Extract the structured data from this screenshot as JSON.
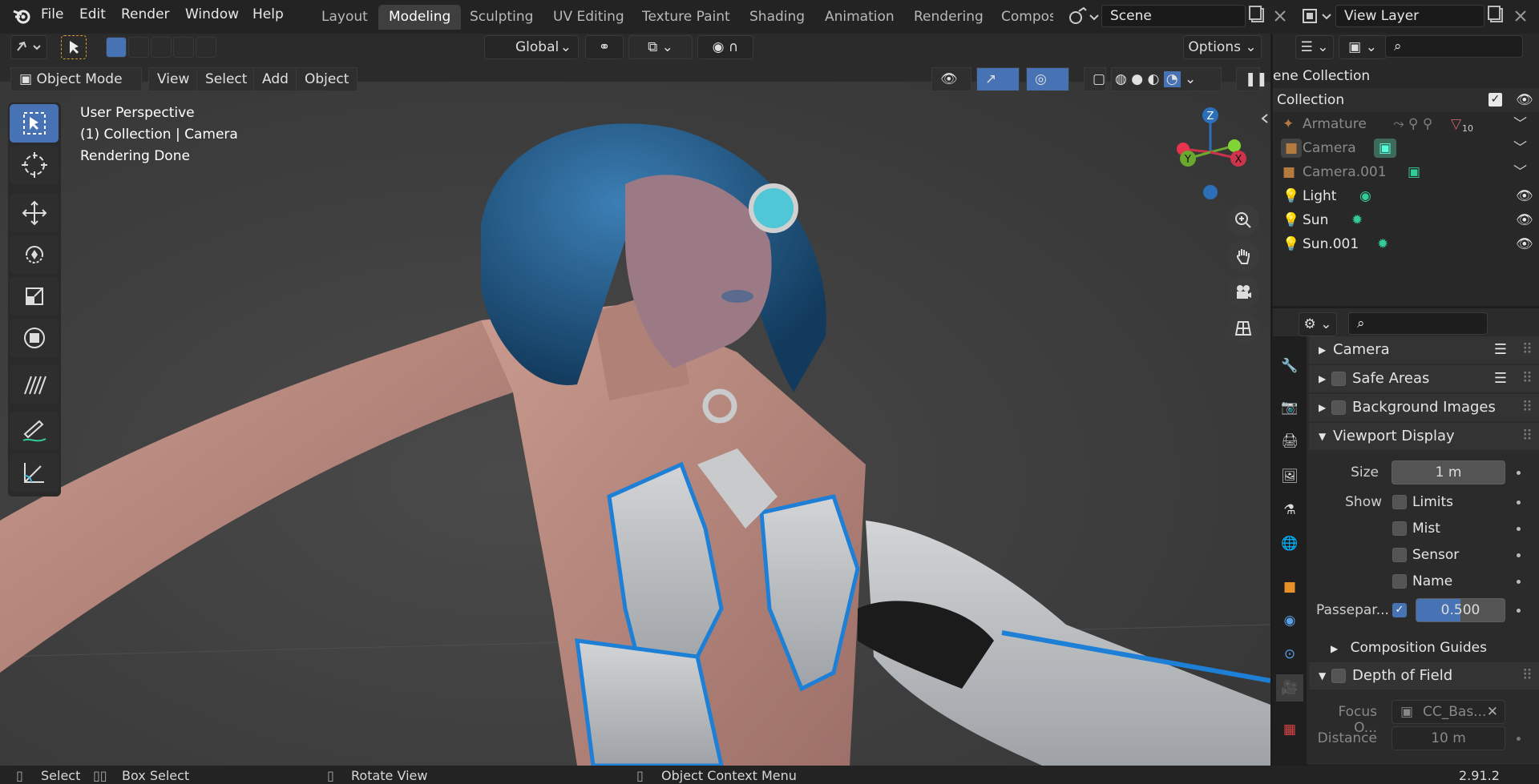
{
  "topbar": {
    "menus": [
      "File",
      "Edit",
      "Render",
      "Window",
      "Help"
    ],
    "workspaces": [
      "Layout",
      "Modeling",
      "Sculpting",
      "UV Editing",
      "Texture Paint",
      "Shading",
      "Animation",
      "Rendering",
      "Compos"
    ],
    "active_workspace": "Modeling",
    "scene": "Scene",
    "view_layer": "View Layer"
  },
  "header": {
    "transform_orientation": "Global",
    "options": "Options",
    "mode": "Object Mode",
    "menus": [
      "View",
      "Select",
      "Add",
      "Object"
    ]
  },
  "viewport": {
    "perspective": "User Perspective",
    "collection_info": "(1) Collection | Camera",
    "status": "Rendering Done",
    "gizmo": {
      "z": "Z",
      "y": "Y",
      "x": "X"
    }
  },
  "outliner": {
    "scene_collection": "ene Collection",
    "collection": "Collection",
    "items": [
      {
        "name": "Armature",
        "icon": "armature-icon",
        "dim": true
      },
      {
        "name": "Camera",
        "icon": "camera-object-icon",
        "dim": true,
        "selected": true
      },
      {
        "name": "Camera.001",
        "icon": "camera-object-icon",
        "dim": true
      },
      {
        "name": "Light",
        "icon": "light-icon",
        "dim": false
      },
      {
        "name": "Sun",
        "icon": "light-icon",
        "dim": false
      },
      {
        "name": "Sun.001",
        "icon": "light-icon",
        "dim": false
      }
    ],
    "armature_badge": "10"
  },
  "properties": {
    "panels": {
      "camera": "Camera",
      "safe_areas": "Safe Areas",
      "background_images": "Background Images",
      "viewport_display": "Viewport Display",
      "composition_guides": "Composition Guides",
      "depth_of_field": "Depth of Field"
    },
    "size_label": "Size",
    "size_value": "1 m",
    "show_label": "Show",
    "show_options": [
      "Limits",
      "Mist",
      "Sensor",
      "Name"
    ],
    "passepartout_label": "Passepar...",
    "passepartout_value": "0.500",
    "passepartout_fraction": 0.5,
    "focus_label": "Focus O...",
    "focus_value": "CC_Bas...",
    "distance_label": "Distance",
    "distance_value": "10 m"
  },
  "statusbar": {
    "select": "Select",
    "box_select": "Box Select",
    "rotate_view": "Rotate View",
    "context_menu": "Object Context Menu",
    "version": "2.91.2"
  },
  "colors": {
    "accent": "#4772b3",
    "panel": "#2b2b2b",
    "header": "#232323"
  }
}
